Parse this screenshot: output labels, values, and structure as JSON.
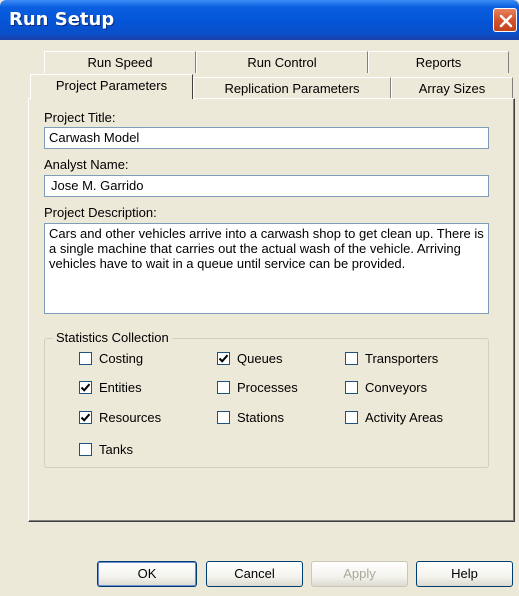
{
  "window": {
    "title": "Run Setup"
  },
  "tabs": {
    "back_row": [
      "Run Speed",
      "Run Control",
      "Reports"
    ],
    "front_row": [
      "Project Parameters",
      "Replication Parameters",
      "Array Sizes"
    ],
    "active": "Project Parameters"
  },
  "form": {
    "project_title_label": "Project Title:",
    "project_title_value": "Carwash Model",
    "analyst_name_label": "Analyst Name:",
    "analyst_name_value": "Jose M. Garrido",
    "project_description_label": "Project Description:",
    "project_description_value": "Cars and other vehicles arrive into a carwash shop to get clean up. There is a single machine that carries out the actual wash of the vehicle. Arriving vehicles have to wait in a queue until service can be provided."
  },
  "statistics": {
    "group_title": "Statistics Collection",
    "options": [
      {
        "label": "Costing",
        "checked": false
      },
      {
        "label": "Entities",
        "checked": true
      },
      {
        "label": "Resources",
        "checked": true
      },
      {
        "label": "Tanks",
        "checked": false
      },
      {
        "label": "Queues",
        "checked": true
      },
      {
        "label": "Processes",
        "checked": false
      },
      {
        "label": "Stations",
        "checked": false
      },
      {
        "label": "Transporters",
        "checked": false
      },
      {
        "label": "Conveyors",
        "checked": false
      },
      {
        "label": "Activity Areas",
        "checked": false
      }
    ]
  },
  "buttons": {
    "ok": "OK",
    "cancel": "Cancel",
    "apply": "Apply",
    "help": "Help"
  }
}
